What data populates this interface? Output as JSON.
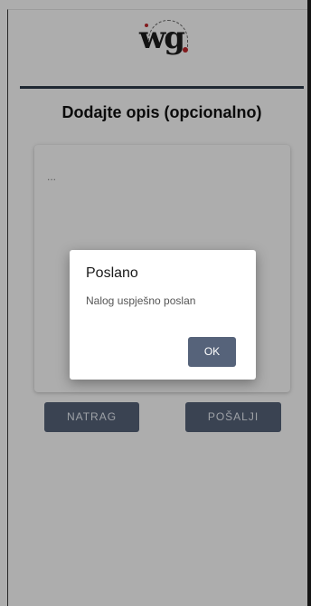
{
  "logo": {
    "text": "wg"
  },
  "page": {
    "title": "Dodajte opis (opcionalno)"
  },
  "description": {
    "placeholder": "..."
  },
  "buttons": {
    "back": "NATRAG",
    "send": "POŠALJI"
  },
  "dialog": {
    "title": "Poslano",
    "message": "Nalog uspješno poslan",
    "ok": "OK"
  },
  "colors": {
    "accent": "#56637a",
    "divider": "#2f3b4c",
    "logo_dot": "#c0282d"
  }
}
